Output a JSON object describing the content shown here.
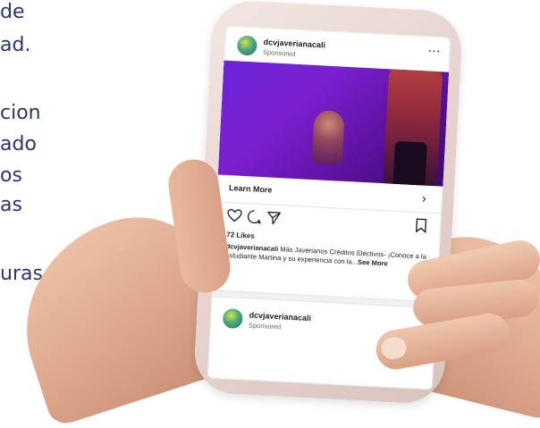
{
  "background_text": {
    "lines": [
      "de",
      "ad.",
      "",
      "cion",
      "ado",
      "os",
      "as",
      "",
      "uras"
    ]
  },
  "post": {
    "username": "dcvjaverianacali",
    "sponsored": "Sponsored",
    "more": "···",
    "cta_label": "Learn More",
    "likes": "72 Likes",
    "caption_user": "dcvjaverianacali",
    "caption_text": " Más Javerianos Créditos Electivos- ¡Conoce a la estudiante Martina y su experiencia con la...",
    "see_more": "See More"
  },
  "next_post": {
    "username": "dcvjaverianacali",
    "sponsored": "Sponsored"
  },
  "colors": {
    "background_text": "#2c3572",
    "media_purple": "#6b24d8",
    "phone_frame": "#e6d3cf"
  }
}
